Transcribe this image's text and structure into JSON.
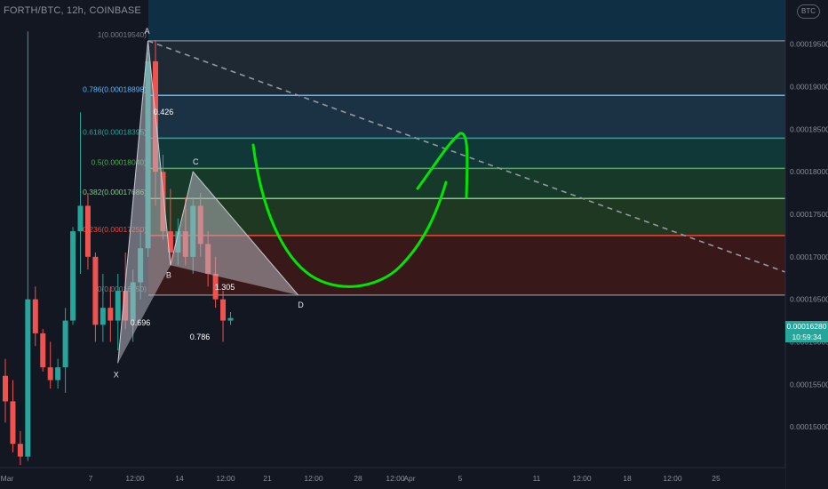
{
  "header": {
    "symbol": "FORTH/BTC, 12h, COINBASE",
    "currency_badge": "BTC"
  },
  "price_tag": {
    "value": "0.00016280",
    "countdown": "10:59:34",
    "color": "#26a69a"
  },
  "colors": {
    "background": "#131722",
    "up": "#26a69a",
    "down": "#ef5350",
    "pattern_fill": "#b2b5be",
    "hand_drawn": "#00e600",
    "trendline": "#9598a1"
  },
  "chart_data": {
    "type": "candlestick",
    "y_axis": {
      "min": 0.0001452,
      "max": 0.0002002,
      "tick_labels": [
        "0.00019500",
        "0.00019000",
        "0.00018500",
        "0.00018000",
        "0.00017500",
        "0.00017000",
        "0.00016500",
        "0.00016000",
        "0.00015500",
        "0.00015000"
      ],
      "tick_values": [
        0.000195,
        0.00019,
        0.000185,
        0.00018,
        0.000175,
        0.00017,
        0.000165,
        0.00016,
        0.000155,
        0.00015
      ]
    },
    "x_axis": {
      "tick_labels": [
        "Mar",
        "7",
        "12:00",
        "14",
        "12:00",
        "21",
        "12:00",
        "28",
        "12:00",
        "Apr",
        "5",
        "11",
        "12:00",
        "18",
        "12:00",
        "25"
      ],
      "bar_interval": "12h"
    },
    "fibonacci": [
      {
        "label": "1(0.00019540)",
        "ratio": 1,
        "price": 0.0001954,
        "color": "#787b86"
      },
      {
        "label": "0.786(0.00018898)",
        "ratio": 0.786,
        "price": 0.00018898,
        "color": "#64b5f6"
      },
      {
        "label": "0.618(0.00018395)",
        "ratio": 0.618,
        "price": 0.00018395,
        "color": "#26a69a"
      },
      {
        "label": "0.5(0.00018040)",
        "ratio": 0.5,
        "price": 0.0001804,
        "color": "#4caf50"
      },
      {
        "label": "0.382(0.00017686)",
        "ratio": 0.382,
        "price": 0.00017686,
        "color": "#81c784"
      },
      {
        "label": "0.236(0.00017250)",
        "ratio": 0.236,
        "price": 0.0001725,
        "color": "#f44336"
      },
      {
        "label": "0(0.00016550)",
        "ratio": 0,
        "price": 0.0001655,
        "color": "#787b86"
      }
    ],
    "xabcd_pattern": {
      "points": [
        {
          "label": "X",
          "bar": 15,
          "price": 0.0001575
        },
        {
          "label": "A",
          "bar": 19,
          "price": 0.0001954
        },
        {
          "label": "B",
          "bar": 22,
          "price": 0.000169
        },
        {
          "label": "C",
          "bar": 25,
          "price": 0.00018
        },
        {
          "label": "D",
          "bar": 39,
          "price": 0.0001655
        }
      ],
      "ratio_labels": [
        "0.426",
        "0.696",
        "1.305",
        "0.786"
      ]
    },
    "candles": [
      {
        "o": 0.000156,
        "h": 0.000158,
        "l": 0.0001505,
        "c": 0.000153
      },
      {
        "o": 0.000153,
        "h": 0.0001555,
        "l": 0.000147,
        "c": 0.000148
      },
      {
        "o": 0.000148,
        "h": 0.0001495,
        "l": 0.0001455,
        "c": 0.0001465
      },
      {
        "o": 0.0001465,
        "h": 0.0001965,
        "l": 0.000146,
        "c": 0.000165
      },
      {
        "o": 0.000165,
        "h": 0.0001665,
        "l": 0.0001595,
        "c": 0.000161
      },
      {
        "o": 0.000161,
        "h": 0.0001615,
        "l": 0.0001565,
        "c": 0.000157
      },
      {
        "o": 0.000157,
        "h": 0.00016,
        "l": 0.0001545,
        "c": 0.0001555
      },
      {
        "o": 0.0001555,
        "h": 0.000158,
        "l": 0.0001545,
        "c": 0.000157
      },
      {
        "o": 0.000157,
        "h": 0.000164,
        "l": 0.000154,
        "c": 0.0001625
      },
      {
        "o": 0.0001625,
        "h": 0.0001735,
        "l": 0.000162,
        "c": 0.000173
      },
      {
        "o": 0.000173,
        "h": 0.000187,
        "l": 0.000168,
        "c": 0.000176
      },
      {
        "o": 0.000176,
        "h": 0.0001775,
        "l": 0.0001685,
        "c": 0.00017
      },
      {
        "o": 0.00017,
        "h": 0.0001705,
        "l": 0.00016,
        "c": 0.000162
      },
      {
        "o": 0.000162,
        "h": 0.000168,
        "l": 0.00016,
        "c": 0.000164
      },
      {
        "o": 0.000164,
        "h": 0.0001665,
        "l": 0.00016,
        "c": 0.0001625
      },
      {
        "o": 0.0001625,
        "h": 0.000168,
        "l": 0.000159,
        "c": 0.000166
      },
      {
        "o": 0.000166,
        "h": 0.0001705,
        "l": 0.0001615,
        "c": 0.0001625
      },
      {
        "o": 0.0001625,
        "h": 0.0001685,
        "l": 0.00016,
        "c": 0.000167
      },
      {
        "o": 0.000167,
        "h": 0.000173,
        "l": 0.000165,
        "c": 0.000171
      },
      {
        "o": 0.000171,
        "h": 0.000194,
        "l": 0.00017,
        "c": 0.000193
      },
      {
        "o": 0.000193,
        "h": 0.0001955,
        "l": 0.000176,
        "c": 0.00018
      },
      {
        "o": 0.00018,
        "h": 0.000182,
        "l": 0.000172,
        "c": 0.000173
      },
      {
        "o": 0.000173,
        "h": 0.000178,
        "l": 0.000169,
        "c": 0.0001705
      },
      {
        "o": 0.0001705,
        "h": 0.0001745,
        "l": 0.000169,
        "c": 0.000173
      },
      {
        "o": 0.000173,
        "h": 0.000177,
        "l": 0.000169,
        "c": 0.00017
      },
      {
        "o": 0.00017,
        "h": 0.000177,
        "l": 0.000168,
        "c": 0.000176
      },
      {
        "o": 0.000176,
        "h": 0.0001775,
        "l": 0.00017,
        "c": 0.0001715
      },
      {
        "o": 0.0001715,
        "h": 0.000173,
        "l": 0.0001665,
        "c": 0.000168
      },
      {
        "o": 0.000168,
        "h": 0.00017,
        "l": 0.000164,
        "c": 0.000165
      },
      {
        "o": 0.000165,
        "h": 0.000166,
        "l": 0.00016,
        "c": 0.0001625
      },
      {
        "o": 0.0001625,
        "h": 0.0001635,
        "l": 0.000162,
        "c": 0.0001628
      }
    ],
    "candle_start_index": 0
  }
}
